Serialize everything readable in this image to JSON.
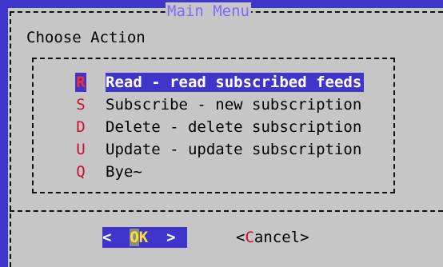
{
  "dialog": {
    "title": "Main Menu",
    "prompt": "Choose Action"
  },
  "menu": {
    "items": [
      {
        "tag": "R",
        "label": "Read - read subscribed feeds",
        "selected": true
      },
      {
        "tag": "S",
        "label": "Subscribe - new subscription",
        "selected": false
      },
      {
        "tag": "D",
        "label": "Delete - delete subscription",
        "selected": false
      },
      {
        "tag": "U",
        "label": "Update - update subscription",
        "selected": false
      },
      {
        "tag": "Q",
        "label": "Bye~",
        "selected": false
      }
    ]
  },
  "buttons": {
    "ok": {
      "open": "<  ",
      "hotkey": "O",
      "rest": "K",
      "close": "  >"
    },
    "cancel": {
      "open": "<",
      "hotkey": "C",
      "rest": "ancel",
      "close": ">"
    }
  },
  "colors": {
    "background": "#3f36c9",
    "dialog": "#c6c6c6",
    "title": "#7d6bff",
    "hotkey": "#c8102e",
    "highlight": "#3f36c9"
  }
}
